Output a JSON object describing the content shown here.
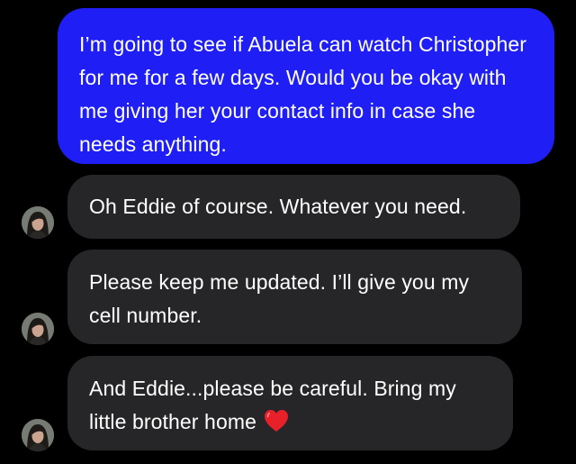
{
  "conversation": {
    "outgoing": [
      {
        "text": "I’m going to see if Abuela can watch Christopher for me for a few days. Would you be okay with me giving her your contact info in case she needs anything."
      }
    ],
    "incoming": [
      {
        "text": "Oh Eddie of course. Whatever you need."
      },
      {
        "text": "Please keep me updated. I’ll give you my cell number."
      },
      {
        "text": "And Eddie...please be careful. Bring my little brother home",
        "emoji": "red-heart-emoji"
      }
    ]
  },
  "colors": {
    "background": "#000000",
    "outgoing_bubble": "#1f1ff5",
    "incoming_bubble": "#262628",
    "text": "#ffffff",
    "heart": "#e8202a"
  },
  "icons": {
    "avatar": "contact-avatar-photo",
    "heart": "red-heart-emoji"
  }
}
